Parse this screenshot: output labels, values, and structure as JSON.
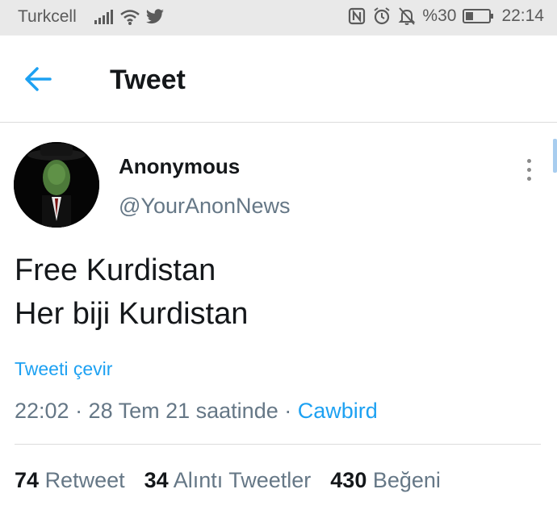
{
  "status_bar": {
    "carrier": "Turkcell",
    "battery": "%30",
    "time": "22:14"
  },
  "header": {
    "title": "Tweet",
    "back_icon": "arrow-left-icon"
  },
  "tweet": {
    "display_name": "Anonymous",
    "handle": "@YourAnonNews",
    "text_lines": [
      "Free Kurdistan",
      "Her biji Kurdistan"
    ],
    "translate_label": "Tweeti çevir",
    "timestamp": "22:02 · 28 Tem 21 saatinde",
    "separator": " · ",
    "source": "Cawbird"
  },
  "stats": {
    "retweets": {
      "count": "74",
      "label": "Retweet"
    },
    "quotes": {
      "count": "34",
      "label": "Alıntı Tweetler"
    },
    "likes": {
      "count": "430",
      "label": "Beğeni"
    }
  },
  "colors": {
    "accent": "#1da1f2",
    "secondary_text": "#657786",
    "primary_text": "#14171a",
    "status_bar_bg": "#e9e9e9"
  }
}
